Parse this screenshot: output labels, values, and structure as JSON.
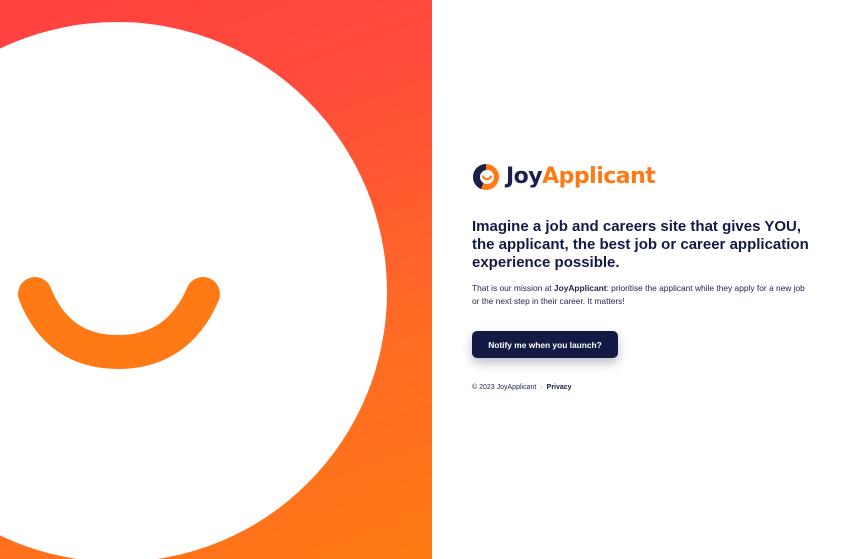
{
  "brand": {
    "name_part1": "Joy",
    "name_part2": "Applicant",
    "colors": {
      "navy": "#1a1f4b",
      "orange": "#ff7a14",
      "red": "#ff4040",
      "white": "#ffffff"
    }
  },
  "hero": {
    "shapes": [
      "white-circle",
      "orange-smile"
    ]
  },
  "main": {
    "headline": "Imagine a job and careers site that gives YOU, the applicant, the best job or career application experience possible.",
    "mission_prefix": "That is our mission at ",
    "mission_brand": "JoyApplicant",
    "mission_suffix": ": prioritise the applicant while they apply for a new job or the next step in their career. It matters!",
    "notify_button_label": "Notify me when you launch?"
  },
  "footer": {
    "copyright": "© 2023 JoyApplicant",
    "separator": "·",
    "privacy_label": "Privacy"
  },
  "icons": {
    "logo": "smiley-location-pin-icon"
  }
}
